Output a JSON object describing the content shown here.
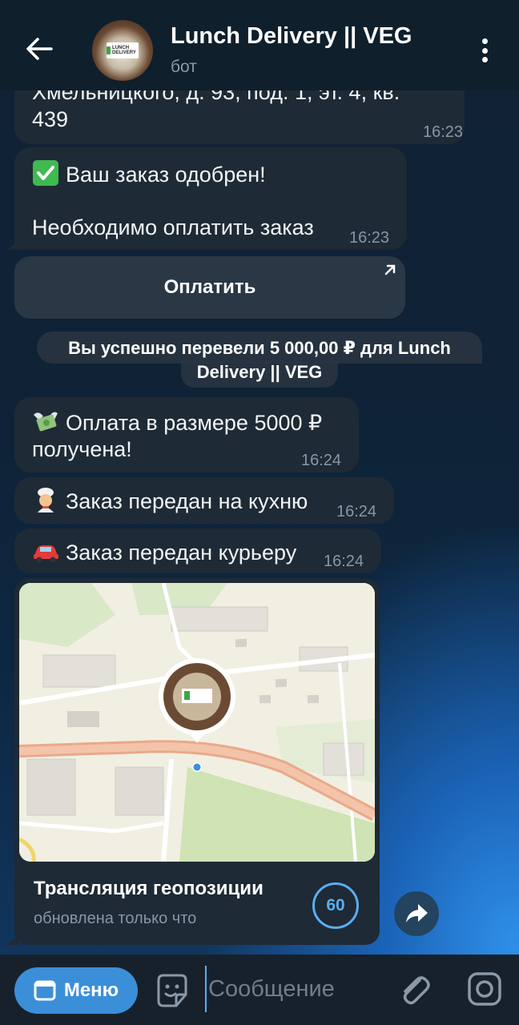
{
  "header": {
    "title": "Lunch Delivery || VEG",
    "subtitle": "бот",
    "avatar_logo_text": "LUNCH DELIVERY"
  },
  "messages": {
    "address_tail": {
      "text": "Хмельницкого, д. 93, под. 1, эт. 4, кв. 439",
      "time": "16:23"
    },
    "approved": {
      "line1": "Ваш заказ одобрен!",
      "line2": "Необходимо оплатить заказ",
      "time": "16:23",
      "emoji": "check-mark-icon"
    },
    "pay_button_label": "Оплатить",
    "service_payment": "Вы успешно перевели 5 000,00 ₽ для Lunch Delivery || VEG",
    "service_line1": "Вы успешно перевели 5 000,00 ₽ для Lunch",
    "service_line2": "Delivery || VEG",
    "payment_received": {
      "line1": "Оплата в размере 5000 ₽",
      "line2": "получена!",
      "time": "16:24",
      "emoji": "money-wings-icon"
    },
    "to_kitchen": {
      "text": "Заказ передан на кухню",
      "time": "16:24",
      "emoji": "cook-icon"
    },
    "to_courier": {
      "text": "Заказ передан курьеру",
      "time": "16:24",
      "emoji": "car-icon"
    },
    "live_location": {
      "title": "Трансляция геопозиции",
      "status": "обновлена только что",
      "timer": "60"
    }
  },
  "composer": {
    "menu_label": "Меню",
    "placeholder": "Сообщение"
  },
  "colors": {
    "accent": "#3b8fd8",
    "bubble": "#1e2a35",
    "header": "#0f1f2c",
    "time": "#8897a5"
  }
}
